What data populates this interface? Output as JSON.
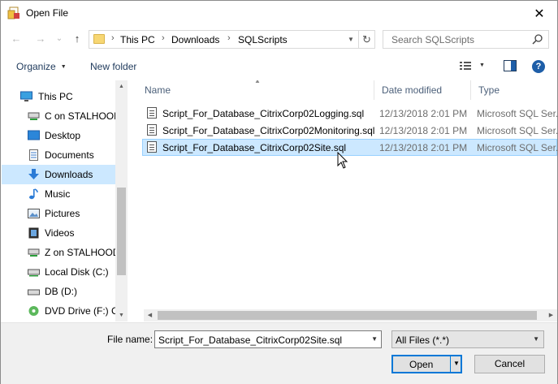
{
  "window": {
    "title": "Open File",
    "close_glyph": "✕"
  },
  "nav": {
    "back_glyph": "←",
    "forward_glyph": "→",
    "recent_glyph": "⌄",
    "up_glyph": "↑",
    "breadcrumb": [
      "This PC",
      "Downloads",
      "SQLScripts"
    ],
    "breadcrumb_sep": "›",
    "refresh_glyph": "↻",
    "search_placeholder": "Search SQLScripts"
  },
  "toolbar": {
    "organize_label": "Organize",
    "new_folder_label": "New folder",
    "help_glyph": "?"
  },
  "sidebar": {
    "items": [
      {
        "label": "This PC",
        "icon": "monitor-icon"
      },
      {
        "label": "C on STALHOOD",
        "icon": "network-drive-icon"
      },
      {
        "label": "Desktop",
        "icon": "desktop-icon"
      },
      {
        "label": "Documents",
        "icon": "documents-icon"
      },
      {
        "label": "Downloads",
        "icon": "downloads-icon",
        "selected": true
      },
      {
        "label": "Music",
        "icon": "music-icon"
      },
      {
        "label": "Pictures",
        "icon": "pictures-icon"
      },
      {
        "label": "Videos",
        "icon": "videos-icon"
      },
      {
        "label": "Z on STALHOOD",
        "icon": "network-drive-icon"
      },
      {
        "label": "Local Disk (C:)",
        "icon": "disk-icon"
      },
      {
        "label": "DB (D:)",
        "icon": "disk-icon"
      },
      {
        "label": "DVD Drive (F:) C\\",
        "icon": "dvd-icon"
      }
    ]
  },
  "columns": {
    "name": "Name",
    "date": "Date modified",
    "type": "Type"
  },
  "files": [
    {
      "name": "Script_For_Database_CitrixCorp02Logging.sql",
      "date": "12/13/2018 2:01 PM",
      "type": "Microsoft SQL Ser..."
    },
    {
      "name": "Script_For_Database_CitrixCorp02Monitoring.sql",
      "date": "12/13/2018 2:01 PM",
      "type": "Microsoft SQL Ser..."
    },
    {
      "name": "Script_For_Database_CitrixCorp02Site.sql",
      "date": "12/13/2018 2:01 PM",
      "type": "Microsoft SQL Ser...",
      "selected": true
    }
  ],
  "footer": {
    "file_name_label": "File name:",
    "file_name_value": "Script_For_Database_CitrixCorp02Site.sql",
    "file_type_value": "All Files (*.*)",
    "open_label": "Open",
    "cancel_label": "Cancel"
  },
  "colors": {
    "selection": "#cce8ff",
    "accent": "#0078d7"
  }
}
